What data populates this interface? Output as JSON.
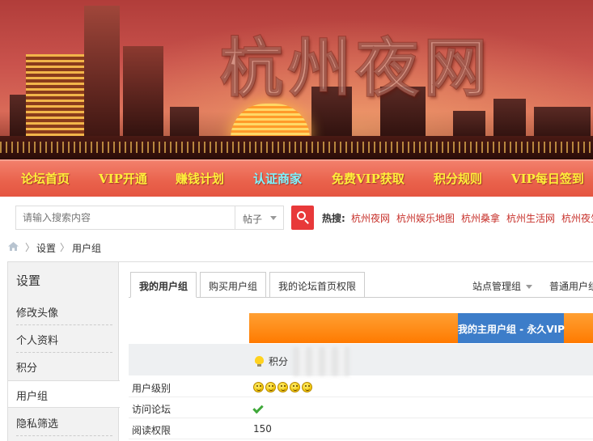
{
  "banner": {
    "title": "杭州夜网"
  },
  "nav": [
    {
      "label": "论坛首页",
      "color": "#ffef3a"
    },
    {
      "label": "VIP开通",
      "color": "#ffef3a"
    },
    {
      "label": "赚钱计划",
      "color": "#ffef3a"
    },
    {
      "label": "认证商家",
      "color": "#7ff5ff"
    },
    {
      "label": "免费VIP获取",
      "color": "#ffef3a"
    },
    {
      "label": "积分规则",
      "color": "#ffef3a"
    },
    {
      "label": "VIP每日签到",
      "color": "#ffef3a"
    }
  ],
  "search": {
    "placeholder": "请输入搜索内容",
    "type_value": "帖子"
  },
  "hot": {
    "label": "热搜:",
    "links": [
      "杭州夜网",
      "杭州娱乐地图",
      "杭州桑拿",
      "杭州生活网",
      "杭州夜生"
    ]
  },
  "breadcrumb": {
    "items": [
      "设置",
      "用户组"
    ]
  },
  "sidebar": {
    "title": "设置",
    "items": [
      "修改头像",
      "个人资料",
      "积分",
      "用户组",
      "隐私筛选"
    ],
    "active_index": 3
  },
  "tabs": [
    "我的用户组",
    "购买用户组",
    "我的论坛首页权限"
  ],
  "tab_right": [
    "站点管理组",
    "普通用户组"
  ],
  "group_bar": {
    "label": "我的主用户组 - 永久VIP"
  },
  "points": {
    "label": "积分"
  },
  "rows": [
    {
      "label": "用户级别"
    },
    {
      "label": "访问论坛"
    },
    {
      "label": "阅读权限",
      "value": "150"
    }
  ],
  "level_smileys": 5,
  "colors": {
    "accent": "#e8393a",
    "nav_yellow": "#ffef3a",
    "group_orange": "#ff7a00",
    "group_blue": "#3d7dc9"
  }
}
